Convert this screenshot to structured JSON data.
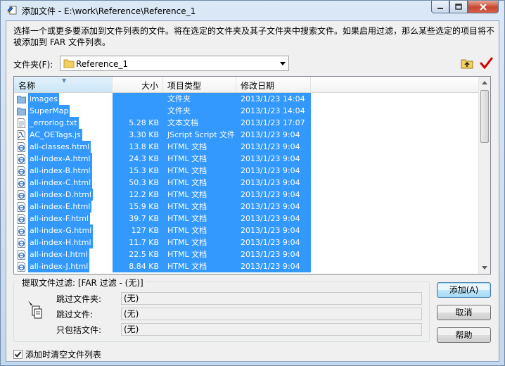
{
  "window": {
    "title": "添加文件 - E:\\work\\Reference\\Reference_1"
  },
  "description": "选择一个或更多要添加到文件列表的文件。将在选定的文件夹及其子文件夹中搜索文件。如果启用过滤，那么某些选定的项目将不被添加到 FAR 文件列表。",
  "folder": {
    "label": "文件夹(F):",
    "value": "Reference_1"
  },
  "columns": {
    "name": "名称",
    "size": "大小",
    "type": "项目类型",
    "date": "修改日期"
  },
  "files": [
    {
      "name": "images",
      "size": "",
      "type": "文件夹",
      "date": "2013/1/23 14:04",
      "icon": "folder-icon"
    },
    {
      "name": "SuperMap",
      "size": "",
      "type": "文件夹",
      "date": "2013/1/23 14:04",
      "icon": "folder-icon"
    },
    {
      "name": "_errorlog.txt",
      "size": "5.28 KB",
      "type": "文本文档",
      "date": "2013/1/23 17:07",
      "icon": "text-file-icon"
    },
    {
      "name": "AC_OETags.js",
      "size": "3.30 KB",
      "type": "JScript Script 文件",
      "date": "2013/1/23 9:04",
      "icon": "script-file-icon"
    },
    {
      "name": "all-classes.html",
      "size": "13.8 KB",
      "type": "HTML 文档",
      "date": "2013/1/23 9:04",
      "icon": "html-file-icon"
    },
    {
      "name": "all-index-A.html",
      "size": "24.3 KB",
      "type": "HTML 文档",
      "date": "2013/1/23 9:04",
      "icon": "html-file-icon"
    },
    {
      "name": "all-index-B.html",
      "size": "15.3 KB",
      "type": "HTML 文档",
      "date": "2013/1/23 9:04",
      "icon": "html-file-icon"
    },
    {
      "name": "all-index-C.html",
      "size": "50.3 KB",
      "type": "HTML 文档",
      "date": "2013/1/23 9:04",
      "icon": "html-file-icon"
    },
    {
      "name": "all-index-D.html",
      "size": "12.2 KB",
      "type": "HTML 文档",
      "date": "2013/1/23 9:04",
      "icon": "html-file-icon"
    },
    {
      "name": "all-index-E.html",
      "size": "15.9 KB",
      "type": "HTML 文档",
      "date": "2013/1/23 9:04",
      "icon": "html-file-icon"
    },
    {
      "name": "all-index-F.html",
      "size": "39.7 KB",
      "type": "HTML 文档",
      "date": "2013/1/23 9:04",
      "icon": "html-file-icon"
    },
    {
      "name": "all-index-G.html",
      "size": "127 KB",
      "type": "HTML 文档",
      "date": "2013/1/23 9:04",
      "icon": "html-file-icon"
    },
    {
      "name": "all-index-H.html",
      "size": "11.7 KB",
      "type": "HTML 文档",
      "date": "2013/1/23 9:04",
      "icon": "html-file-icon"
    },
    {
      "name": "all-index-I.html",
      "size": "22.5 KB",
      "type": "HTML 文档",
      "date": "2013/1/23 9:04",
      "icon": "html-file-icon"
    },
    {
      "name": "all-index-J.html",
      "size": "8.84 KB",
      "type": "HTML 文档",
      "date": "2013/1/23 9:04",
      "icon": "html-file-icon"
    }
  ],
  "filter": {
    "title": "提取文件过滤: [FAR 过滤 - (无)]",
    "skip_folders_label": "跳过文件夹:",
    "skip_folders_value": "(无)",
    "skip_files_label": "跳过文件:",
    "skip_files_value": "(无)",
    "include_only_label": "只包括文件:",
    "include_only_value": "(无)"
  },
  "buttons": {
    "add": "添加(A)",
    "cancel": "取消",
    "help": "帮助"
  },
  "clear_on_add": {
    "label": "添加时清空文件列表",
    "checked": true
  },
  "colors": {
    "selection": "#3399ff",
    "accent_check": "#d40000"
  }
}
